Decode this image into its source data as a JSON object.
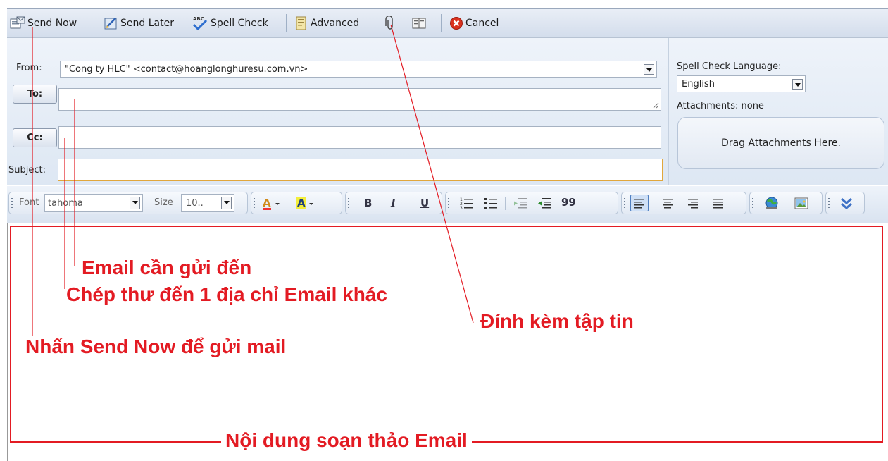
{
  "toolbar": {
    "send_now": "Send Now",
    "send_later": "Send Later",
    "spell_check": "Spell Check",
    "advanced": "Advanced",
    "cancel": "Cancel"
  },
  "header": {
    "from_label": "From:",
    "from_value": "\"Cong ty HLC\" <contact@hoanglonghuresu.com.vn>",
    "to_button": "To:",
    "cc_button": "Cc:",
    "subject_label": "Subject:",
    "to_value": "",
    "cc_value": "",
    "subject_value": "",
    "spell_lang_label": "Spell Check Language:",
    "spell_lang_value": "English",
    "attachments_status": "Attachments: none",
    "drop_zone": "Drag Attachments Here."
  },
  "format_bar": {
    "font_label": "Font",
    "font_value": "tahoma",
    "size_label": "Size",
    "size_value": "10..",
    "bold": "B",
    "italic": "I",
    "underline": "U",
    "blockquote": "99"
  },
  "annotations": {
    "email_to": "Email cần gửi đến",
    "cc_note": "Chép thư đến 1 địa chỉ Email khác",
    "attach_note": "Đính kèm tập tin",
    "send_note": "Nhấn Send Now để gửi mail",
    "body_note": "Nội dung soạn thảo Email"
  },
  "colors": {
    "annotation": "#e31b23",
    "toolbar_bg": "#dde6f2",
    "cancel_icon": "#d9321f"
  },
  "icons": [
    "send-now-icon",
    "send-later-icon",
    "spell-check-icon",
    "advanced-icon",
    "paperclip-icon",
    "address-book-icon",
    "cancel-icon"
  ]
}
